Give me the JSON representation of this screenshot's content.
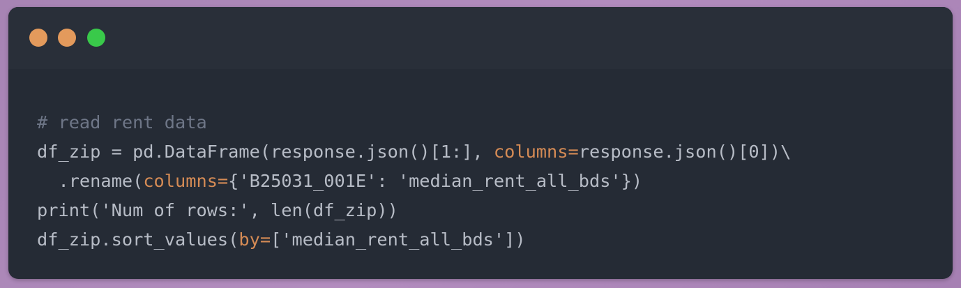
{
  "window": {
    "controls": [
      {
        "name": "close",
        "color": "#e39a5c"
      },
      {
        "name": "minimize",
        "color": "#e39a5c"
      },
      {
        "name": "maximize",
        "color": "#39c94a"
      }
    ]
  },
  "code": {
    "language": "python",
    "lines": {
      "l1": {
        "comment": "# read rent data"
      },
      "l2": {
        "pre": "df_zip = pd.DataFrame(response.json()[1:], ",
        "kw": "columns=",
        "post": "response.json()[0])\\"
      },
      "l3": {
        "pre": "  .rename(",
        "kw": "columns=",
        "post": "{'B25031_001E': 'median_rent_all_bds'})"
      },
      "l4": {
        "text": "print('Num of rows:', len(df_zip))"
      },
      "l5": {
        "pre": "df_zip.sort_values(",
        "kw": "by=",
        "post": "['median_rent_all_bds'])"
      }
    }
  }
}
